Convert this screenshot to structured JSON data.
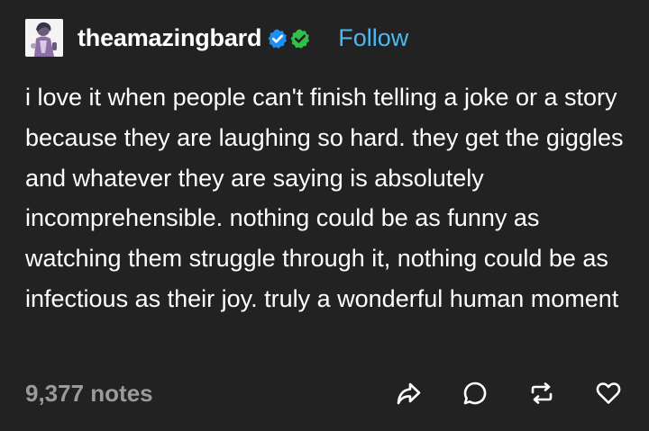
{
  "post": {
    "username": "theamazingbard",
    "follow_label": "Follow",
    "body": "i love it when people can't finish telling a joke or a story because they are laughing so hard. they get the giggles and whatever they are saying is absolutely incomprehensible. nothing could be as funny as watching them struggle through it, nothing could be as infectious as their joy. truly a wonderful human moment",
    "notes": "9,377 notes"
  },
  "icons": {
    "avatar": "user-avatar",
    "badge_blue": "blue-verified-check-icon",
    "badge_green": "green-verified-check-icon",
    "share": "share-arrow-icon",
    "reply": "reply-bubble-icon",
    "reblog": "reblog-icon",
    "like": "heart-icon"
  },
  "colors": {
    "background": "#222222",
    "text": "#ffffff",
    "follow": "#4db8f0",
    "muted": "#9a9a9a",
    "badge_blue": "#1e8ff0",
    "badge_green": "#2fbf4a"
  }
}
